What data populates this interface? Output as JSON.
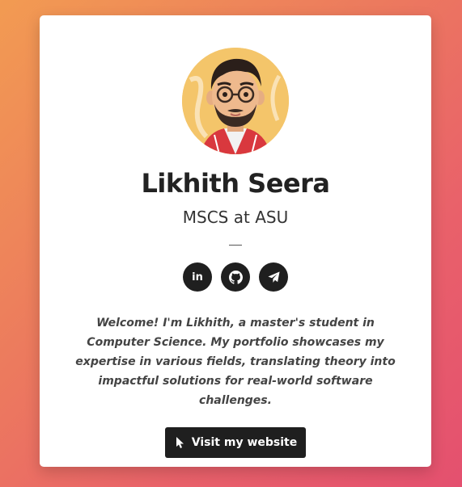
{
  "profile": {
    "name": "Likhith Seera",
    "subtitle": "MSCS at ASU",
    "bio": "Welcome! I'm Likhith, a master's student in Computer Science. My portfolio showcases my expertise in various fields, translating theory into impactful solutions for real-world software challenges."
  },
  "socials": [
    {
      "icon": "linkedin-icon",
      "label": "in"
    },
    {
      "icon": "github-icon"
    },
    {
      "icon": "telegram-icon"
    }
  ],
  "cta": {
    "label": "Visit my website",
    "icon": "pointer-cursor-icon"
  },
  "colors": {
    "background_start": "#f29b52",
    "background_end": "#e4506f",
    "card": "#ffffff",
    "button": "#1f1f1f",
    "text": "#222222",
    "avatar_bg": "#f4c56a"
  }
}
